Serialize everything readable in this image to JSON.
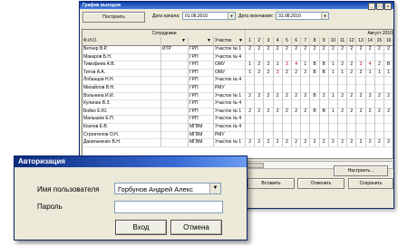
{
  "main_window": {
    "title": "График выходов",
    "build_button": "Построить",
    "start_date_label": "Дата начала:",
    "start_date": "01.08.2010",
    "end_date_label": "Дата окончания:",
    "end_date": "31.08.2010",
    "header_group_staff": "Сотрудники",
    "header_group_month": "Август 2010",
    "col_fio": "Ф.И.О.",
    "col_section": "Участок",
    "days": [
      "1",
      "2",
      "3",
      "4",
      "5",
      "6",
      "7",
      "8",
      "9",
      "10",
      "11",
      "12",
      "13",
      "14",
      "15",
      "16"
    ],
    "rows": [
      {
        "fio": "Ветнер В.Р.",
        "a": "ИТР",
        "b": "ГРП",
        "section": "Участок № 1",
        "d": [
          "2",
          "2",
          "2",
          "2",
          "2",
          "2",
          "2",
          "2",
          "2",
          "2",
          "2",
          "2",
          "2",
          "2",
          "2",
          "2"
        ]
      },
      {
        "fio": "Макаров Б.Н.",
        "a": "",
        "b": "ГРП",
        "section": "Участок № 4",
        "d": [
          "",
          "",
          "",
          "",
          "",
          "",
          "",
          "",
          "",
          "",
          "",
          "",
          "",
          "",
          "",
          ""
        ]
      },
      {
        "fio": "Тимофеев А.В.",
        "a": "",
        "b": "ГРП",
        "section": "ОМУ",
        "d": [
          "1",
          "2",
          "2",
          "1",
          "3",
          "4",
          "1",
          "В",
          "В",
          "1",
          "2",
          "2",
          "3",
          "4",
          "2",
          "В"
        ]
      },
      {
        "fio": "Титов А.А.",
        "a": "",
        "b": "ГРП",
        "section": "ОМУ",
        "d": [
          "1",
          "2",
          "2",
          "3",
          "2",
          "2",
          "2",
          "В",
          "В",
          "1",
          "1",
          "2",
          "2",
          "1",
          "1",
          "1"
        ]
      },
      {
        "fio": "Лобанцов Н.Н.",
        "a": "",
        "b": "ГРП",
        "section": "Участок № 4",
        "d": [
          "",
          "",
          "",
          "",
          "",
          "",
          "",
          "",
          "",
          "",
          "",
          "",
          "",
          "",
          "",
          ""
        ]
      },
      {
        "fio": "Михайлов В.Н.",
        "a": "",
        "b": "ГРП",
        "section": "РМУ",
        "d": [
          "",
          "",
          "",
          "",
          "",
          "",
          "",
          "",
          "",
          "",
          "",
          "",
          "",
          "",
          "",
          ""
        ]
      },
      {
        "fio": "Вольнина И.И.",
        "a": "",
        "b": "ГРП",
        "section": "Участок № 1",
        "d": [
          "2",
          "2",
          "2",
          "2",
          "2",
          "2",
          "2",
          "В",
          "2",
          "1",
          "2",
          "2",
          "2",
          "2",
          "2",
          "2"
        ]
      },
      {
        "fio": "Кулинин В.З.",
        "a": "",
        "b": "ГРП",
        "section": "Участок № 4",
        "d": [
          "",
          "",
          "",
          "",
          "",
          "",
          "",
          "",
          "",
          "",
          "",
          "",
          "",
          "",
          "",
          ""
        ]
      },
      {
        "fio": "Бойко Е.Ю.",
        "a": "",
        "b": "ГРП",
        "section": "Участок № 1",
        "d": [
          "2",
          "2",
          "2",
          "2",
          "2",
          "2",
          "2",
          "В",
          "В",
          "1",
          "2",
          "2",
          "2",
          "2",
          "2",
          "2"
        ]
      },
      {
        "fio": "Малышев Е.П.",
        "a": "",
        "b": "ГРП",
        "section": "Участок № 4",
        "d": [
          "",
          "",
          "",
          "",
          "",
          "",
          "",
          "",
          "",
          "",
          "",
          "",
          "",
          "",
          "",
          ""
        ]
      },
      {
        "fio": "Козлов Е.В.",
        "a": "",
        "b": "МГВМ",
        "section": "Участок № 4",
        "d": [
          "",
          "",
          "",
          "",
          "",
          "",
          "",
          "",
          "",
          "",
          "",
          "",
          "",
          "",
          "",
          ""
        ]
      },
      {
        "fio": "Строителов О.Н.",
        "a": "",
        "b": "МГВМ",
        "section": "РМУ",
        "d": [
          "",
          "",
          "",
          "",
          "",
          "",
          "",
          "",
          "",
          "",
          "",
          "",
          "",
          "",
          "",
          ""
        ]
      },
      {
        "fio": "Данильченко В.Н.",
        "a": "",
        "b": "МГВМ",
        "section": "Участок № 1",
        "d": [
          "2",
          "2",
          "2",
          "2",
          "2",
          "2",
          "2",
          "2",
          "2",
          "2",
          "2",
          "2",
          "2",
          "2",
          "2",
          "2"
        ]
      }
    ],
    "settings_button": "Настроить...",
    "insert_button": "Вставить",
    "cancel_button": "Отменить",
    "save_button": "Сохранить"
  },
  "login": {
    "title": "Авторизация",
    "username_label": "Имя пользователя",
    "username_value": "Горбунов Андрей Алекс",
    "password_label": "Пароль",
    "password_value": "",
    "ok_button": "Вход",
    "cancel_button": "Отмена"
  }
}
